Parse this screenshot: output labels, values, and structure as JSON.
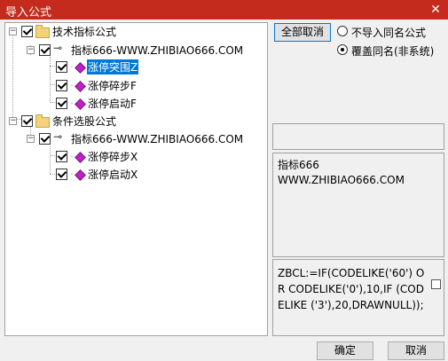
{
  "window": {
    "title": "导入公式",
    "close_glyph": "✕"
  },
  "tree": {
    "groups": [
      {
        "label": "技术指标公式",
        "checked": true,
        "item": {
          "label": "指标666-WWW.ZHIBIAO666.COM",
          "checked": true,
          "children": [
            {
              "label": "涨停突围Z",
              "checked": true,
              "selected": true
            },
            {
              "label": "涨停碎步F",
              "checked": true,
              "selected": false
            },
            {
              "label": "涨停启动F",
              "checked": true,
              "selected": false
            }
          ]
        }
      },
      {
        "label": "条件选股公式",
        "checked": true,
        "item": {
          "label": "指标666-WWW.ZHIBIAO666.COM",
          "checked": true,
          "children": [
            {
              "label": "涨停碎步X",
              "checked": true,
              "selected": false
            },
            {
              "label": "涨停启动X",
              "checked": true,
              "selected": false
            }
          ]
        }
      }
    ]
  },
  "options": {
    "deselect_all_label": "全部取消",
    "radio_no_import": "不导入同名公式",
    "radio_overwrite": "覆盖同名(非系统)",
    "selected": "overwrite"
  },
  "info": {
    "line1": "指标666",
    "line2": "WWW.ZHIBIAO666.COM"
  },
  "formula": {
    "text": "ZBCL:=IF(CODELIKE('60') OR CODELIKE('0'),10,IF (CODELIKE ('3'),20,DRAWNULL));",
    "checkbox_checked": false
  },
  "footer": {
    "ok_label": "确定",
    "cancel_label": "取消"
  }
}
